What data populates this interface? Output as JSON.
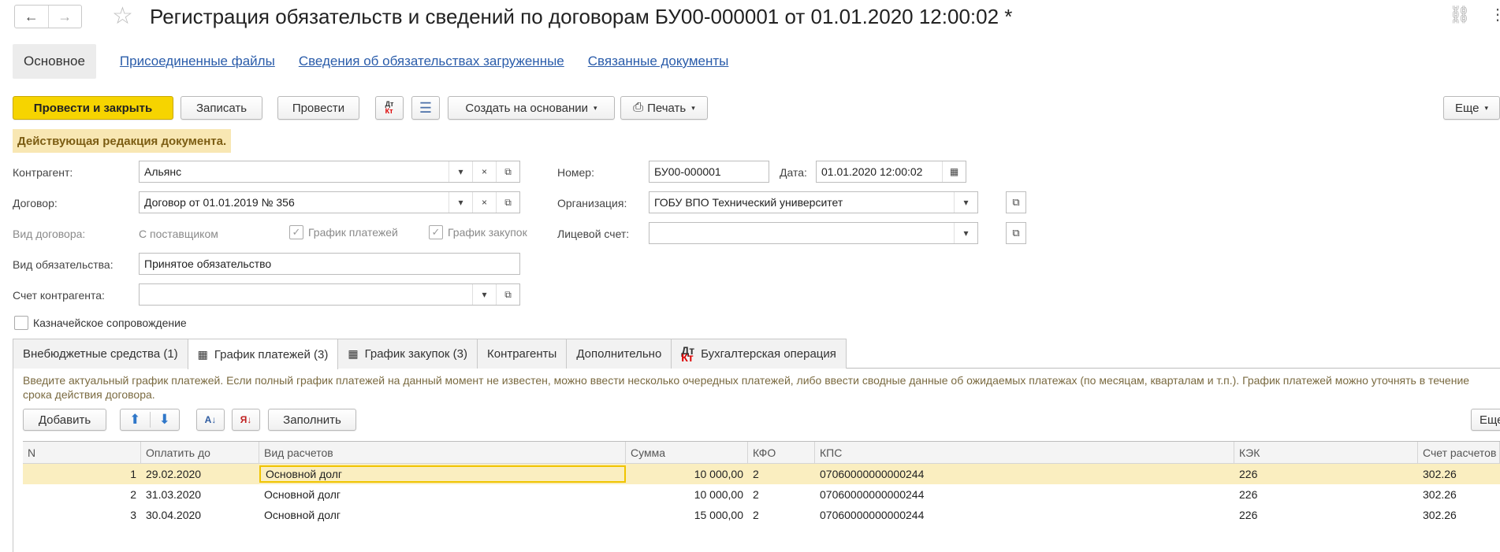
{
  "title": "Регистрация обязательств и сведений по договорам БУ00-000001 от 01.01.2020 12:00:02 *",
  "toplinks": {
    "main": "Основное",
    "attached": "Присоединенные файлы",
    "loaded": "Сведения об обязательствах загруженные",
    "related": "Связанные документы"
  },
  "toolbar": {
    "post_close": "Провести и закрыть",
    "save": "Записать",
    "post": "Провести",
    "create_based": "Создать на основании",
    "print": "Печать",
    "more": "Еще"
  },
  "notice": "Действующая редакция документа.",
  "form": {
    "kontragent_label": "Контрагент:",
    "kontragent_value": "Альянс",
    "dogovor_label": "Договор:",
    "dogovor_value": "Договор от 01.01.2019 № 356",
    "vid_dogovora_label": "Вид договора:",
    "vid_dogovora_value": "С поставщиком",
    "grafik_platezhey": "График платежей",
    "grafik_zakupok": "График закупок",
    "vid_obyaz_label": "Вид обязательства:",
    "vid_obyaz_value": "Принятое обязательство",
    "schet_label": "Счет контрагента:",
    "schet_value": "",
    "kazn": "Казначейское сопровождение",
    "nomer_label": "Номер:",
    "nomer_value": "БУ00-000001",
    "data_label": "Дата:",
    "data_value": "01.01.2020 12:00:02",
    "org_label": "Организация:",
    "org_value": "ГОБУ ВПО Технический университет",
    "licevoy_label": "Лицевой счет:",
    "licevoy_value": ""
  },
  "tabs": [
    {
      "label": "Внебюджетные средства (1)"
    },
    {
      "label": "График платежей (3)"
    },
    {
      "label": "График закупок (3)"
    },
    {
      "label": "Контрагенты"
    },
    {
      "label": "Дополнительно"
    },
    {
      "label": "Бухгалтерская операция"
    }
  ],
  "hint": "Введите актуальный график платежей. Если полный график платежей на данный момент не известен, можно ввести несколько очередных платежей, либо ввести сводные данные об ожидаемых платежах (по месяцам, кварталам и т.п.). График платежей можно уточнять в течение срока действия договора.",
  "subtoolbar": {
    "add": "Добавить",
    "fill": "Заполнить",
    "more": "Еще"
  },
  "table": {
    "headers": [
      "N",
      "Оплатить до",
      "Вид расчетов",
      "Сумма",
      "КФО",
      "КПС",
      "КЭК",
      "Счет расчетов"
    ],
    "rows": [
      [
        "1",
        "29.02.2020",
        "Основной долг",
        "10 000,00",
        "2",
        "07060000000000244",
        "226",
        "302.26"
      ],
      [
        "2",
        "31.03.2020",
        "Основной долг",
        "10 000,00",
        "2",
        "07060000000000244",
        "226",
        "302.26"
      ],
      [
        "3",
        "30.04.2020",
        "Основной долг",
        "15 000,00",
        "2",
        "07060000000000244",
        "226",
        "302.26"
      ]
    ]
  },
  "icons": {
    "back": "←",
    "forward": "→",
    "star": "☆",
    "link": "⛓",
    "dots": "⋮",
    "dropdown": "▾",
    "clear": "×",
    "open": "⧉",
    "calendar": "▦",
    "check": "✓",
    "up": "⬆",
    "down": "⬇",
    "printer": "⎙",
    "list": "☰",
    "dt": "Дт",
    "kt": "Кт",
    "sort_az": "А↓",
    "sort_za": "Я↓"
  },
  "colors": {
    "primary": "#f6d400",
    "link": "#2a5caa",
    "notice_bg": "#f8e7b3",
    "row_selected": "#faeec0"
  }
}
